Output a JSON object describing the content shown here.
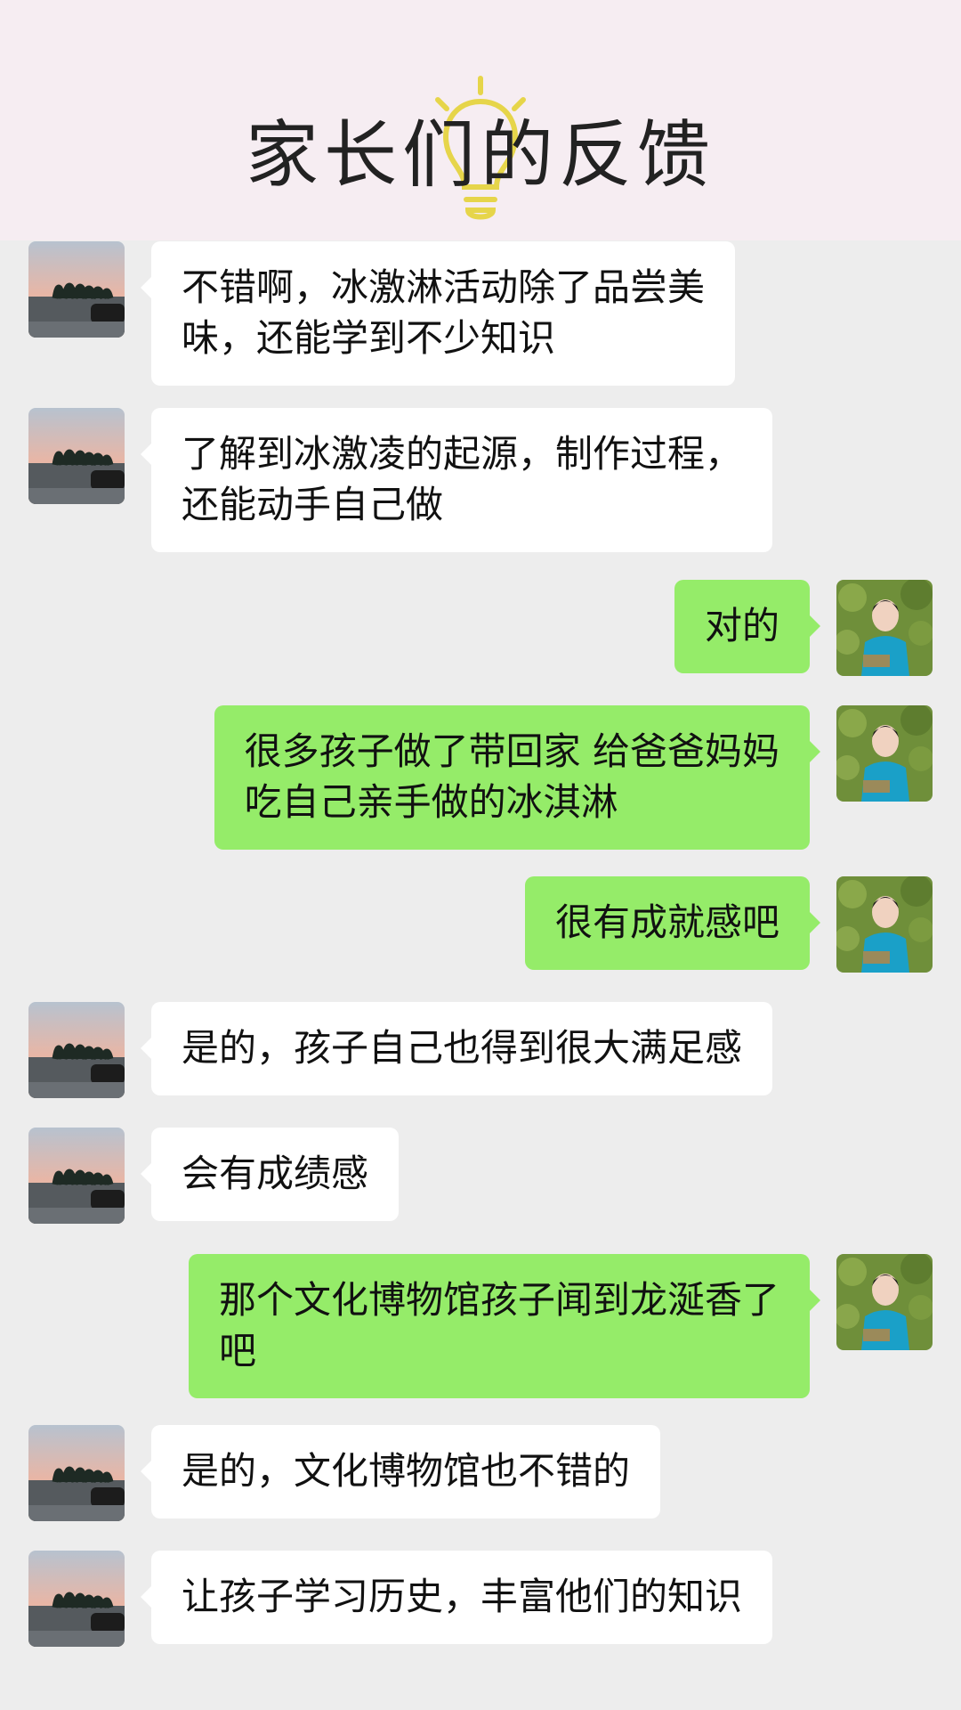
{
  "header": {
    "title": "家长们的反馈",
    "icon": "lightbulb-icon",
    "bulb_color": "#e6d54a",
    "bg": "#f6edf2"
  },
  "colors": {
    "chat_bg": "#ededed",
    "incoming_bubble": "#ffffff",
    "outgoing_bubble": "#95ec69"
  },
  "messages": [
    {
      "side": "left",
      "text": "不错啊，冰激淋活动除了品尝美\n味，还能学到不少知识"
    },
    {
      "side": "left",
      "text": "了解到冰激凌的起源，制作过程，\n还能动手自己做"
    },
    {
      "side": "right",
      "text": "对的"
    },
    {
      "side": "right",
      "text": "很多孩子做了带回家 给爸爸妈妈\n吃自己亲手做的冰淇淋"
    },
    {
      "side": "right",
      "text": "很有成就感吧"
    },
    {
      "side": "left",
      "text": "是的，孩子自己也得到很大满足感"
    },
    {
      "side": "left",
      "text": "会有成绩感"
    },
    {
      "side": "right",
      "text": "那个文化博物馆孩子闻到龙涎香了\n吧"
    },
    {
      "side": "left",
      "text": "是的，文化博物馆也不错的"
    },
    {
      "side": "left",
      "text": "让孩子学习历史，丰富他们的知识"
    }
  ]
}
